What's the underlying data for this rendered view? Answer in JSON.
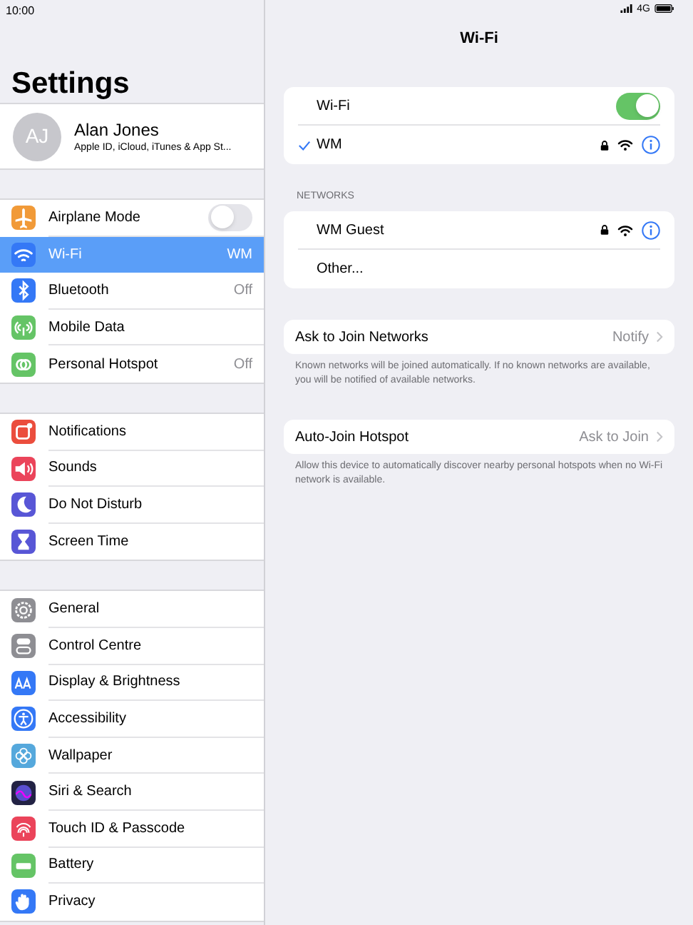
{
  "status_bar": {
    "time": "10:00",
    "network": "4G"
  },
  "sidebar": {
    "title": "Settings",
    "profile": {
      "initials": "AJ",
      "name": "Alan Jones",
      "subtitle": "Apple ID, iCloud, iTunes & App St..."
    },
    "groups": [
      [
        {
          "label": "Airplane Mode",
          "color": "#f19a38",
          "kind": "toggle",
          "on": false,
          "selected": false
        },
        {
          "label": "Wi-Fi",
          "color": "#3478f6",
          "kind": "value",
          "value": "WM",
          "selected": true
        },
        {
          "label": "Bluetooth",
          "color": "#3478f6",
          "kind": "value",
          "value": "Off",
          "selected": false
        },
        {
          "label": "Mobile Data",
          "color": "#65c466",
          "kind": "plain",
          "selected": false
        },
        {
          "label": "Personal Hotspot",
          "color": "#65c466",
          "kind": "value",
          "value": "Off",
          "selected": false
        }
      ],
      [
        {
          "label": "Notifications",
          "color": "#eb4d3d",
          "kind": "plain",
          "selected": false
        },
        {
          "label": "Sounds",
          "color": "#eb445a",
          "kind": "plain",
          "selected": false
        },
        {
          "label": "Do Not Disturb",
          "color": "#5856d6",
          "kind": "plain",
          "selected": false
        },
        {
          "label": "Screen Time",
          "color": "#5856d6",
          "kind": "plain",
          "selected": false
        }
      ],
      [
        {
          "label": "General",
          "color": "#8e8e93",
          "kind": "plain",
          "selected": false
        },
        {
          "label": "Control Centre",
          "color": "#8e8e93",
          "kind": "plain",
          "selected": false
        },
        {
          "label": "Display & Brightness",
          "color": "#3478f6",
          "kind": "plain",
          "selected": false
        },
        {
          "label": "Accessibility",
          "color": "#3478f6",
          "kind": "plain",
          "selected": false
        },
        {
          "label": "Wallpaper",
          "color": "#55a8dc",
          "kind": "plain",
          "selected": false
        },
        {
          "label": "Siri & Search",
          "color": "#222244",
          "kind": "plain",
          "selected": false
        },
        {
          "label": "Touch ID & Passcode",
          "color": "#eb445a",
          "kind": "plain",
          "selected": false
        },
        {
          "label": "Battery",
          "color": "#65c466",
          "kind": "plain",
          "selected": false
        },
        {
          "label": "Privacy",
          "color": "#3478f6",
          "kind": "plain",
          "selected": false
        }
      ]
    ]
  },
  "detail": {
    "title": "Wi-Fi",
    "wifi_card": {
      "toggle_label": "Wi-Fi",
      "on": true,
      "connected": {
        "name": "WM",
        "checked": true,
        "locked": true
      }
    },
    "networks_header": "NETWORKS",
    "networks": [
      {
        "name": "WM Guest",
        "kind": "network",
        "locked": true
      },
      {
        "name": "Other...",
        "kind": "other"
      }
    ],
    "settings": [
      {
        "label": "Ask to Join Networks",
        "value": "Notify",
        "footer": "Known networks will be joined automatically. If no known networks are available, you will be notified of available networks."
      },
      {
        "label": "Auto-Join Hotspot",
        "value": "Ask to Join",
        "footer": "Allow this device to automatically discover nearby personal hotspots when no Wi-Fi network is available."
      }
    ]
  }
}
